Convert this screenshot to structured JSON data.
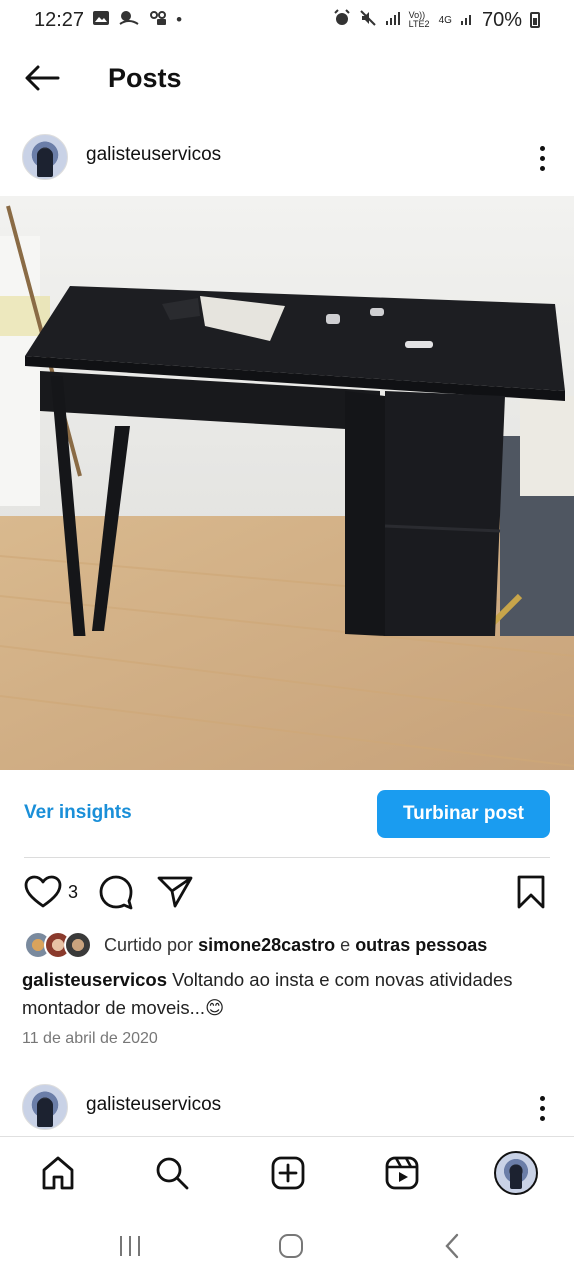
{
  "status_bar": {
    "time": "12:27",
    "dot": "•",
    "network": "Vo)) LTE2",
    "network_type": "4G",
    "battery": "70%",
    "icons": [
      "gallery-icon",
      "app-notification-icon",
      "voicemail-icon",
      "alarm-icon",
      "mute-icon",
      "signal-icon",
      "battery-icon"
    ]
  },
  "nav": {
    "title": "Posts",
    "back_icon": "arrow-left-icon"
  },
  "post": {
    "username": "galisteuservicos",
    "photo_description_icon": "photo",
    "insights_label": "Ver insights",
    "boost_label": "Turbinar post",
    "like_count": "3",
    "liked_by_prefix": "Curtido por",
    "liked_by_user": "simone28castro",
    "liked_by_and": "e",
    "liked_by_others": "outras pessoas",
    "caption_user": "galisteuservicos",
    "caption_text": "Voltando ao insta e com novas atividades montador de moveis...😊",
    "date": "11 de abril de 2020"
  },
  "next_post": {
    "username": "galisteuservicos"
  },
  "colors": {
    "accent": "#1a9cf0",
    "link": "#1a8fd8"
  }
}
